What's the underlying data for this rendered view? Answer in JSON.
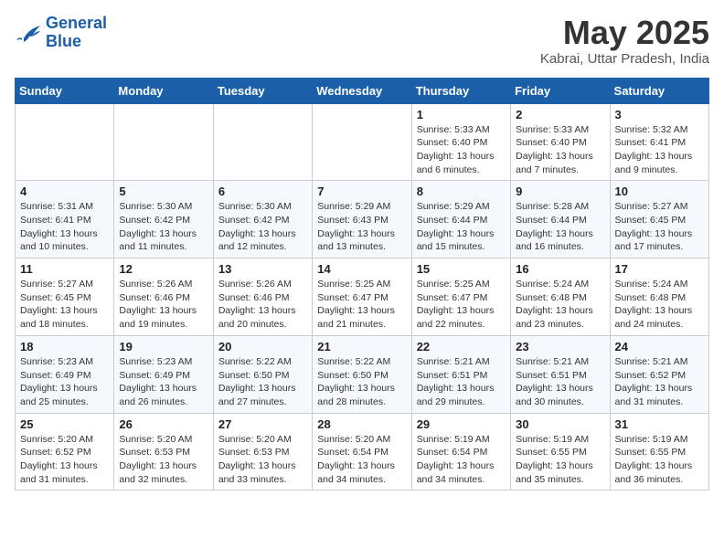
{
  "logo": {
    "line1": "General",
    "line2": "Blue"
  },
  "title": {
    "month": "May 2025",
    "location": "Kabrai, Uttar Pradesh, India"
  },
  "weekdays": [
    "Sunday",
    "Monday",
    "Tuesday",
    "Wednesday",
    "Thursday",
    "Friday",
    "Saturday"
  ],
  "weeks": [
    [
      {
        "day": "",
        "info": ""
      },
      {
        "day": "",
        "info": ""
      },
      {
        "day": "",
        "info": ""
      },
      {
        "day": "",
        "info": ""
      },
      {
        "day": "1",
        "info": "Sunrise: 5:33 AM\nSunset: 6:40 PM\nDaylight: 13 hours\nand 6 minutes."
      },
      {
        "day": "2",
        "info": "Sunrise: 5:33 AM\nSunset: 6:40 PM\nDaylight: 13 hours\nand 7 minutes."
      },
      {
        "day": "3",
        "info": "Sunrise: 5:32 AM\nSunset: 6:41 PM\nDaylight: 13 hours\nand 9 minutes."
      }
    ],
    [
      {
        "day": "4",
        "info": "Sunrise: 5:31 AM\nSunset: 6:41 PM\nDaylight: 13 hours\nand 10 minutes."
      },
      {
        "day": "5",
        "info": "Sunrise: 5:30 AM\nSunset: 6:42 PM\nDaylight: 13 hours\nand 11 minutes."
      },
      {
        "day": "6",
        "info": "Sunrise: 5:30 AM\nSunset: 6:42 PM\nDaylight: 13 hours\nand 12 minutes."
      },
      {
        "day": "7",
        "info": "Sunrise: 5:29 AM\nSunset: 6:43 PM\nDaylight: 13 hours\nand 13 minutes."
      },
      {
        "day": "8",
        "info": "Sunrise: 5:29 AM\nSunset: 6:44 PM\nDaylight: 13 hours\nand 15 minutes."
      },
      {
        "day": "9",
        "info": "Sunrise: 5:28 AM\nSunset: 6:44 PM\nDaylight: 13 hours\nand 16 minutes."
      },
      {
        "day": "10",
        "info": "Sunrise: 5:27 AM\nSunset: 6:45 PM\nDaylight: 13 hours\nand 17 minutes."
      }
    ],
    [
      {
        "day": "11",
        "info": "Sunrise: 5:27 AM\nSunset: 6:45 PM\nDaylight: 13 hours\nand 18 minutes."
      },
      {
        "day": "12",
        "info": "Sunrise: 5:26 AM\nSunset: 6:46 PM\nDaylight: 13 hours\nand 19 minutes."
      },
      {
        "day": "13",
        "info": "Sunrise: 5:26 AM\nSunset: 6:46 PM\nDaylight: 13 hours\nand 20 minutes."
      },
      {
        "day": "14",
        "info": "Sunrise: 5:25 AM\nSunset: 6:47 PM\nDaylight: 13 hours\nand 21 minutes."
      },
      {
        "day": "15",
        "info": "Sunrise: 5:25 AM\nSunset: 6:47 PM\nDaylight: 13 hours\nand 22 minutes."
      },
      {
        "day": "16",
        "info": "Sunrise: 5:24 AM\nSunset: 6:48 PM\nDaylight: 13 hours\nand 23 minutes."
      },
      {
        "day": "17",
        "info": "Sunrise: 5:24 AM\nSunset: 6:48 PM\nDaylight: 13 hours\nand 24 minutes."
      }
    ],
    [
      {
        "day": "18",
        "info": "Sunrise: 5:23 AM\nSunset: 6:49 PM\nDaylight: 13 hours\nand 25 minutes."
      },
      {
        "day": "19",
        "info": "Sunrise: 5:23 AM\nSunset: 6:49 PM\nDaylight: 13 hours\nand 26 minutes."
      },
      {
        "day": "20",
        "info": "Sunrise: 5:22 AM\nSunset: 6:50 PM\nDaylight: 13 hours\nand 27 minutes."
      },
      {
        "day": "21",
        "info": "Sunrise: 5:22 AM\nSunset: 6:50 PM\nDaylight: 13 hours\nand 28 minutes."
      },
      {
        "day": "22",
        "info": "Sunrise: 5:21 AM\nSunset: 6:51 PM\nDaylight: 13 hours\nand 29 minutes."
      },
      {
        "day": "23",
        "info": "Sunrise: 5:21 AM\nSunset: 6:51 PM\nDaylight: 13 hours\nand 30 minutes."
      },
      {
        "day": "24",
        "info": "Sunrise: 5:21 AM\nSunset: 6:52 PM\nDaylight: 13 hours\nand 31 minutes."
      }
    ],
    [
      {
        "day": "25",
        "info": "Sunrise: 5:20 AM\nSunset: 6:52 PM\nDaylight: 13 hours\nand 31 minutes."
      },
      {
        "day": "26",
        "info": "Sunrise: 5:20 AM\nSunset: 6:53 PM\nDaylight: 13 hours\nand 32 minutes."
      },
      {
        "day": "27",
        "info": "Sunrise: 5:20 AM\nSunset: 6:53 PM\nDaylight: 13 hours\nand 33 minutes."
      },
      {
        "day": "28",
        "info": "Sunrise: 5:20 AM\nSunset: 6:54 PM\nDaylight: 13 hours\nand 34 minutes."
      },
      {
        "day": "29",
        "info": "Sunrise: 5:19 AM\nSunset: 6:54 PM\nDaylight: 13 hours\nand 34 minutes."
      },
      {
        "day": "30",
        "info": "Sunrise: 5:19 AM\nSunset: 6:55 PM\nDaylight: 13 hours\nand 35 minutes."
      },
      {
        "day": "31",
        "info": "Sunrise: 5:19 AM\nSunset: 6:55 PM\nDaylight: 13 hours\nand 36 minutes."
      }
    ]
  ]
}
